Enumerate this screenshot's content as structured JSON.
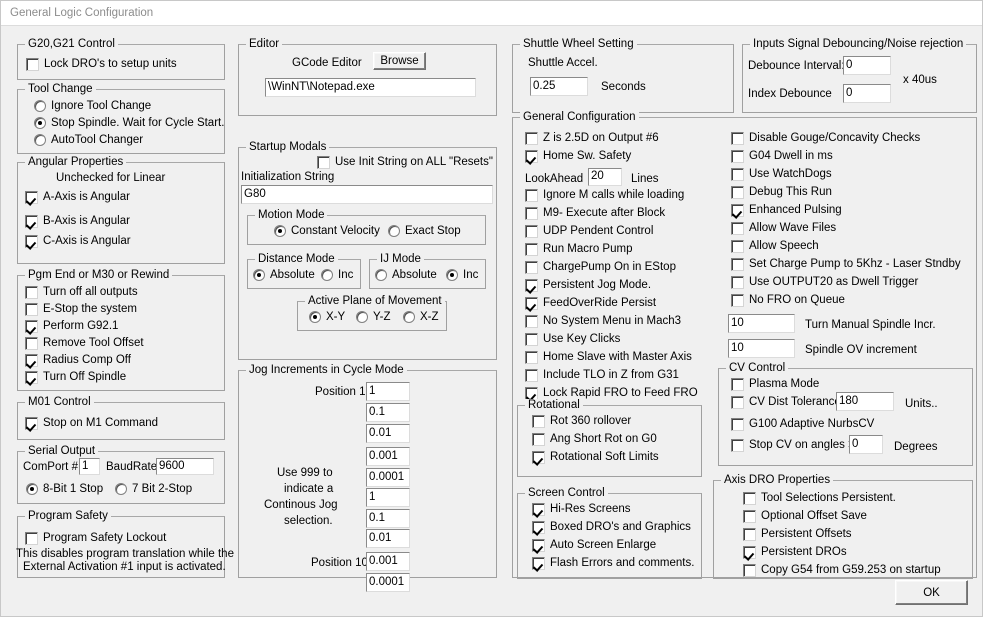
{
  "window": {
    "title": "General Logic Configuration"
  },
  "g20g21": {
    "legend": "G20,G21 Control",
    "lock_dro": "Lock DRO's to setup units"
  },
  "tool_change": {
    "legend": "Tool Change",
    "opt_ignore": "Ignore Tool Change",
    "opt_stop": "Stop Spindle. Wait for Cycle Start.",
    "opt_auto": "AutoTool Changer"
  },
  "angular": {
    "legend": "Angular Properties",
    "note": "Unchecked for Linear",
    "a_axis": "A-Axis is Angular",
    "b_axis": "B-Axis is Angular",
    "c_axis": "C-Axis is Angular"
  },
  "pgm_end": {
    "legend": "Pgm End or M30 or Rewind",
    "turn_off_all": "Turn off all outputs",
    "estop": "E-Stop the system",
    "g92": "Perform G92.1",
    "remove_tool_offset": "Remove Tool Offset",
    "radius_comp": "Radius Comp Off",
    "turn_off_spindle": "Turn Off Spindle"
  },
  "m01": {
    "legend": "M01 Control",
    "stop_m1": "Stop on M1 Command"
  },
  "serial": {
    "legend": "Serial Output",
    "comport_label": "ComPort #",
    "comport_value": "1",
    "baud_label": "BaudRate",
    "baud_value": "9600",
    "opt_8bit": "8-Bit 1 Stop",
    "opt_7bit": "7 Bit 2-Stop"
  },
  "program_safety": {
    "legend": "Program Safety",
    "lockout": "Program Safety Lockout",
    "desc_line1": "This disables program translation while the",
    "desc_line2": "External Activation #1 input is activated."
  },
  "editor": {
    "legend": "Editor",
    "gcode_editor_label": "GCode Editor",
    "browse_label": "Browse",
    "path_value": "\\WinNT\\Notepad.exe"
  },
  "startup_modals": {
    "legend": "Startup Modals",
    "use_init_string": "Use Init String on ALL  \"Resets\"",
    "init_string_label": "Initialization String",
    "init_string_value": "G80",
    "motion_mode": {
      "legend": "Motion Mode",
      "constant_velocity": "Constant Velocity",
      "exact_stop": "Exact Stop"
    },
    "distance_mode": {
      "legend": "Distance Mode",
      "absolute": "Absolute",
      "inc": "Inc"
    },
    "ij_mode": {
      "legend": "IJ Mode",
      "absolute": "Absolute",
      "inc": "Inc"
    },
    "active_plane": {
      "legend": "Active Plane of Movement",
      "xy": "X-Y",
      "yz": "Y-Z",
      "xz": "X-Z"
    }
  },
  "jog": {
    "legend": "Jog Increments in Cycle Mode",
    "position1_label": "Position 1",
    "position10_label": "Position 10",
    "note_line1": "Use 999 to",
    "note_line2": "indicate a",
    "note_line3": "Continous Jog",
    "note_line4": "selection.",
    "values": [
      "1",
      "0.1",
      "0.01",
      "0.001",
      "0.0001",
      "1",
      "0.1",
      "0.01",
      "0.001",
      "0.0001"
    ]
  },
  "shuttle": {
    "legend": "Shuttle Wheel Setting",
    "accel_label": "Shuttle Accel.",
    "accel_value": "0.25",
    "seconds_label": "Seconds"
  },
  "debounce": {
    "legend": "Inputs Signal Debouncing/Noise rejection",
    "interval_label": "Debounce Interval:",
    "interval_value": "0",
    "index_label": "Index Debounce",
    "index_value": "0",
    "units_label": "x 40us"
  },
  "general_config": {
    "legend": "General Configuration",
    "left_items": [
      {
        "label": "Z is 2.5D on Output #6",
        "checked": false
      },
      {
        "label": "Home Sw. Safety",
        "checked": true
      },
      {
        "label": "Ignore M calls while loading",
        "checked": false
      },
      {
        "label": "M9- Execute after Block",
        "checked": false
      },
      {
        "label": "UDP Pendent Control",
        "checked": false
      },
      {
        "label": "Run Macro Pump",
        "checked": false
      },
      {
        "label": "ChargePump On in EStop",
        "checked": false
      },
      {
        "label": "Persistent Jog Mode.",
        "checked": true
      },
      {
        "label": "FeedOverRide Persist",
        "checked": true
      },
      {
        "label": "No System Menu in Mach3",
        "checked": false
      },
      {
        "label": "Use Key Clicks",
        "checked": false
      },
      {
        "label": "Home Slave with Master Axis",
        "checked": false
      },
      {
        "label": "Include TLO in Z from G31",
        "checked": false
      },
      {
        "label": "Lock Rapid FRO to Feed FRO",
        "checked": true
      }
    ],
    "lookahead_label": "LookAhead",
    "lookahead_value": "20",
    "lines_label": "Lines",
    "right_items": [
      {
        "label": "Disable Gouge/Concavity Checks",
        "checked": false
      },
      {
        "label": "G04 Dwell in ms",
        "checked": false
      },
      {
        "label": "Use WatchDogs",
        "checked": false
      },
      {
        "label": "Debug This Run",
        "checked": false
      },
      {
        "label": "Enhanced Pulsing",
        "checked": true
      },
      {
        "label": "Allow Wave Files",
        "checked": false
      },
      {
        "label": "Allow Speech",
        "checked": false
      },
      {
        "label": "Set Charge Pump to 5Khz  - Laser Stndby",
        "checked": false
      },
      {
        "label": "Use OUTPUT20 as Dwell Trigger",
        "checked": false
      },
      {
        "label": "No FRO on Queue",
        "checked": false
      }
    ],
    "spindle_incr_value": "10",
    "spindle_incr_label": "Turn Manual Spindle Incr.",
    "spindle_ov_value": "10",
    "spindle_ov_label": "Spindle OV increment"
  },
  "rotational": {
    "legend": "Rotational",
    "rot360": "Rot 360 rollover",
    "ang_short": "Ang Short Rot on G0",
    "soft_limits": "Rotational Soft Limits"
  },
  "screen_control": {
    "legend": "Screen Control",
    "hires": "Hi-Res Screens",
    "boxed": "Boxed DRO's and Graphics",
    "auto_enlarge": "Auto Screen Enlarge",
    "flash_errors": "Flash Errors and comments."
  },
  "cv_control": {
    "legend": "CV Control",
    "plasma": "Plasma Mode",
    "dist_tolerance": "CV Dist Tolerance",
    "dist_tolerance_value": "180",
    "units_label": "Units..",
    "nurbs": "G100 Adaptive NurbsCV",
    "stop_cv": "Stop CV on angles >",
    "stop_cv_value": "0",
    "degrees_label": "Degrees"
  },
  "axis_dro": {
    "legend": "Axis DRO Properties",
    "tool_sel": "Tool Selections Persistent.",
    "optional_offset": "Optional Offset Save",
    "persistent_offsets": "Persistent Offsets",
    "persistent_dros": "Persistent DROs",
    "copy_g54": "Copy G54 from G59.253 on startup"
  },
  "ok_button": {
    "label": "OK"
  }
}
